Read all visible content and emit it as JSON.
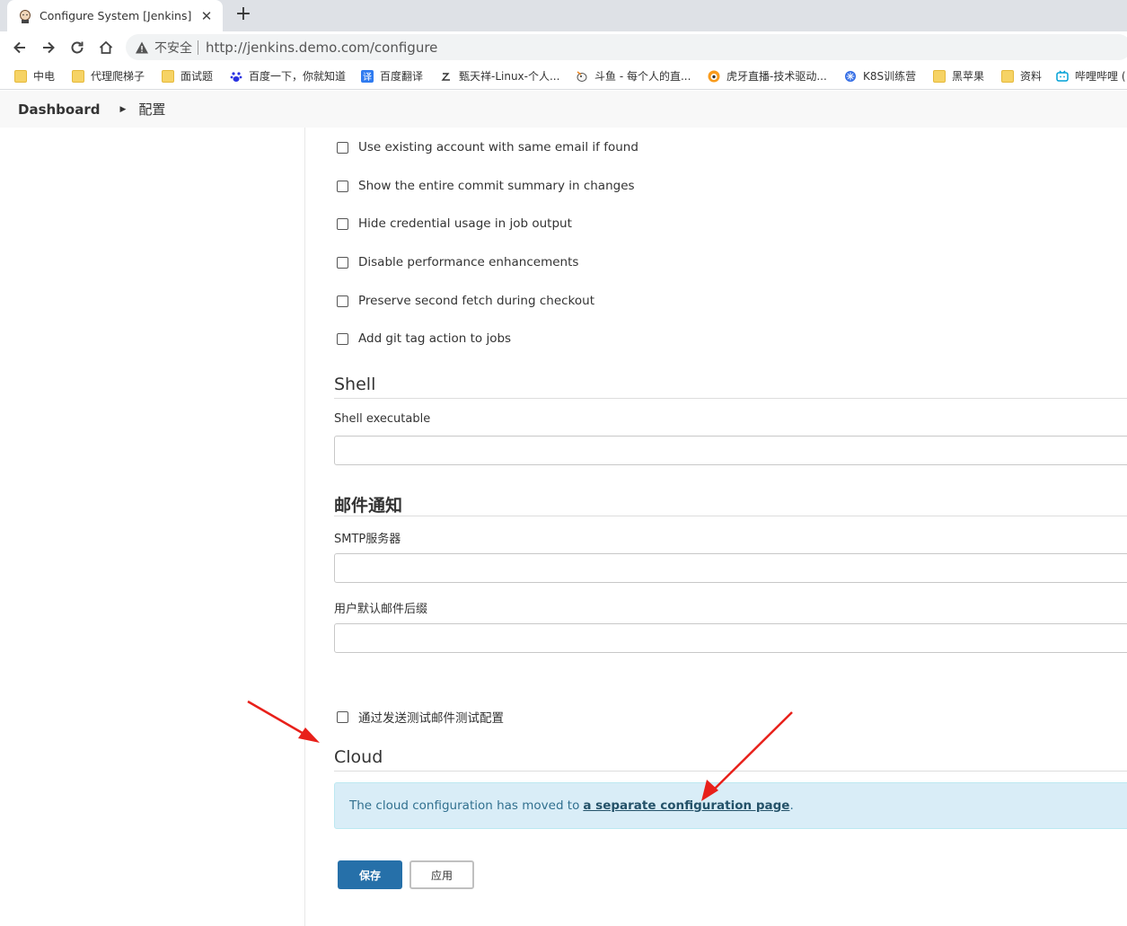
{
  "browser": {
    "tab_title": "Configure System [Jenkins]",
    "insecure_label": "不安全",
    "url": "http://jenkins.demo.com/configure"
  },
  "bookmarks": [
    {
      "label": "中电",
      "icon": "folder-icon"
    },
    {
      "label": "代理爬梯子",
      "icon": "folder-icon"
    },
    {
      "label": "面试题",
      "icon": "folder-icon"
    },
    {
      "label": "百度一下，你就知道",
      "icon": "baidu-icon"
    },
    {
      "label": "百度翻译",
      "icon": "translate-icon"
    },
    {
      "label": "甄天祥-Linux-个人...",
      "icon": "blog-icon"
    },
    {
      "label": "斗鱼 - 每个人的直...",
      "icon": "douyu-icon"
    },
    {
      "label": "虎牙直播-技术驱动...",
      "icon": "huya-icon"
    },
    {
      "label": "K8S训练营",
      "icon": "k8s-icon"
    },
    {
      "label": "黑苹果",
      "icon": "folder-icon"
    },
    {
      "label": "资料",
      "icon": "folder-icon"
    },
    {
      "label": "哔哩哔哩 (",
      "icon": "bilibili-icon"
    }
  ],
  "breadcrumb": {
    "dashboard": "Dashboard",
    "current": "配置"
  },
  "git_options": [
    "Use existing account with same email if found",
    "Show the entire commit summary in changes",
    "Hide credential usage in job output",
    "Disable performance enhancements",
    "Preserve second fetch during checkout",
    "Add git tag action to jobs"
  ],
  "shell": {
    "title": "Shell",
    "executable_label": "Shell executable",
    "executable_value": ""
  },
  "email": {
    "title": "邮件通知",
    "smtp_label": "SMTP服务器",
    "smtp_value": "",
    "suffix_label": "用户默认邮件后缀",
    "suffix_value": "",
    "test_label": "通过发送测试邮件测试配置"
  },
  "cloud": {
    "title": "Cloud",
    "notice_text": "The cloud configuration has moved to",
    "notice_link": "a separate configuration page",
    "notice_end": "."
  },
  "buttons": {
    "save": "保存",
    "apply": "应用"
  },
  "colors": {
    "primary_button": "#2670a9",
    "notice_bg": "#d9edf7",
    "annotation_arrow": "#e8201a"
  }
}
